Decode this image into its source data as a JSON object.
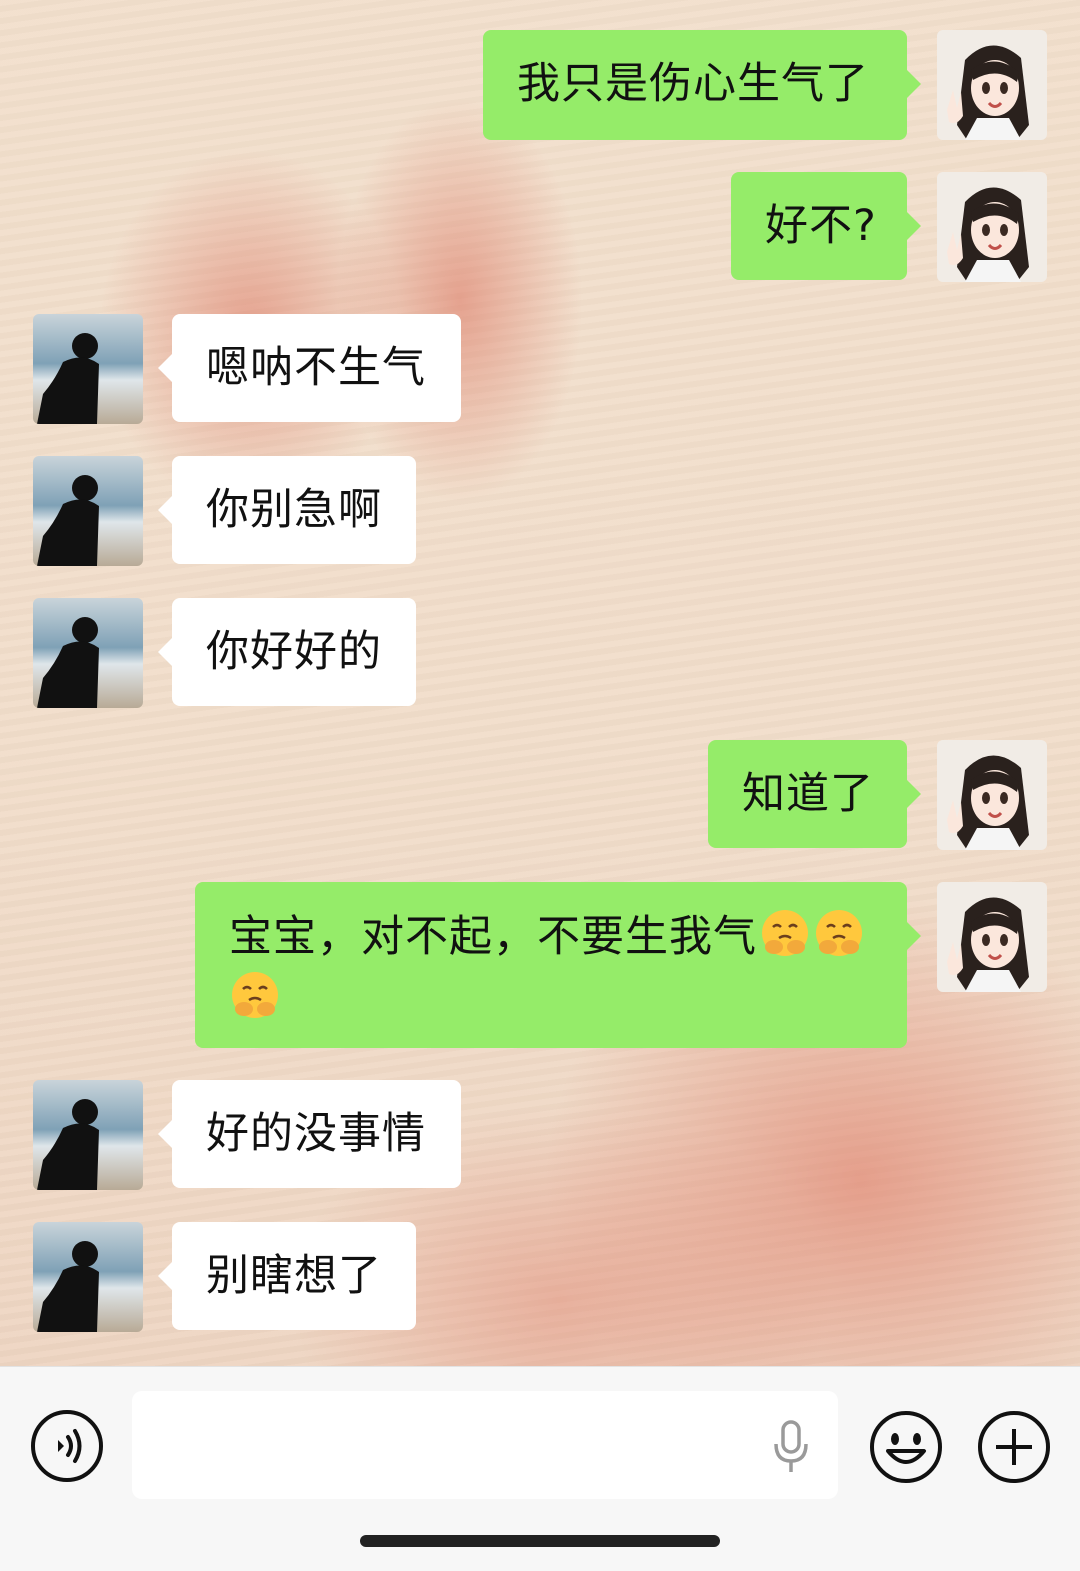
{
  "messages": [
    {
      "side": "out",
      "text": "我只是伤心生气了"
    },
    {
      "side": "out",
      "text": "好不?"
    },
    {
      "side": "in",
      "text": "嗯呐不生气"
    },
    {
      "side": "in",
      "text": "你别急啊"
    },
    {
      "side": "in",
      "text": "你好好的"
    },
    {
      "side": "out",
      "text": "知道了"
    },
    {
      "side": "out",
      "text_line1": "宝宝，对不起，不要生我气",
      "emoji": "pleading-hands-face-emoji"
    },
    {
      "side": "in",
      "text": "好的没事情"
    },
    {
      "side": "in",
      "text": "别瞎想了"
    }
  ],
  "input": {
    "value": "",
    "placeholder": ""
  },
  "icons": {
    "voice": "voice-wave-icon",
    "mic": "microphone-icon",
    "emoji": "smiley-face-icon",
    "plus": "plus-circle-icon"
  },
  "colors": {
    "sent_bubble": "#95ec69",
    "received_bubble": "#ffffff"
  }
}
